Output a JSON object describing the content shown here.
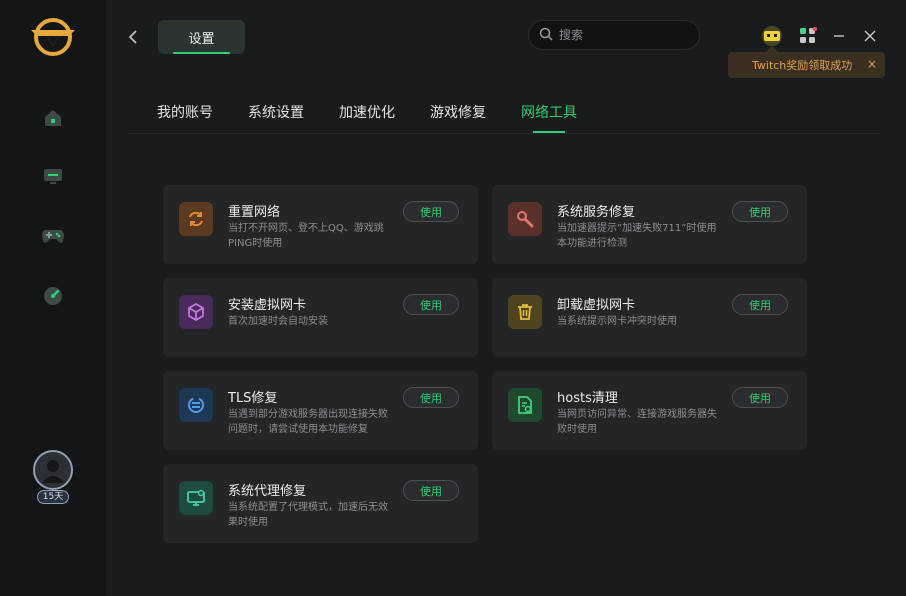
{
  "header": {
    "settings_label": "设置",
    "search_placeholder": "搜索"
  },
  "toast": {
    "message": "Twitch奖励领取成功",
    "close": "×"
  },
  "sidebar": {
    "level_badge": "15天"
  },
  "tabs": [
    {
      "label": "我的账号"
    },
    {
      "label": "系统设置"
    },
    {
      "label": "加速优化"
    },
    {
      "label": "游戏修复"
    },
    {
      "label": "网络工具"
    }
  ],
  "active_tab": "网络工具",
  "colors": {
    "accent": "#2fcf72",
    "toast_text": "#e0a14c"
  },
  "tools": [
    {
      "title": "重置网络",
      "desc": "当打不开网页、登不上QQ、游戏跳PING时使用",
      "button": "使用",
      "icon": "refresh-icon",
      "icon_bg": "#5a3a20",
      "icon_color": "#e6883a"
    },
    {
      "title": "系统服务修复",
      "desc": "当加速器提示“加速失败711”时使用本功能进行检测",
      "button": "使用",
      "icon": "wrench-icon",
      "icon_bg": "#5a302b",
      "icon_color": "#e0786a"
    },
    {
      "title": "安装虚拟网卡",
      "desc": "首次加速时会自动安装",
      "button": "使用",
      "icon": "cube-icon",
      "icon_bg": "#4a2a5a",
      "icon_color": "#c07ae0"
    },
    {
      "title": "卸载虚拟网卡",
      "desc": "当系统提示网卡冲突时使用",
      "button": "使用",
      "icon": "trash-icon",
      "icon_bg": "#4f4420",
      "icon_color": "#e0b93a"
    },
    {
      "title": "TLS修复",
      "desc": "当遇到部分游戏服务器出现连接失败问题时，请尝试使用本功能修复",
      "button": "使用",
      "icon": "tls-sync-icon",
      "icon_bg": "#1f3856",
      "icon_color": "#4f9ce8"
    },
    {
      "title": "hosts清理",
      "desc": "当网页访问异常、连接游戏服务器失败时使用",
      "button": "使用",
      "icon": "document-clean-icon",
      "icon_bg": "#1f4a30",
      "icon_color": "#3fd37a"
    },
    {
      "title": "系统代理修复",
      "desc": "当系统配置了代理模式，加速后无效果时使用",
      "button": "使用",
      "icon": "monitor-proxy-icon",
      "icon_bg": "#1f4a40",
      "icon_color": "#3fd3a8"
    }
  ]
}
